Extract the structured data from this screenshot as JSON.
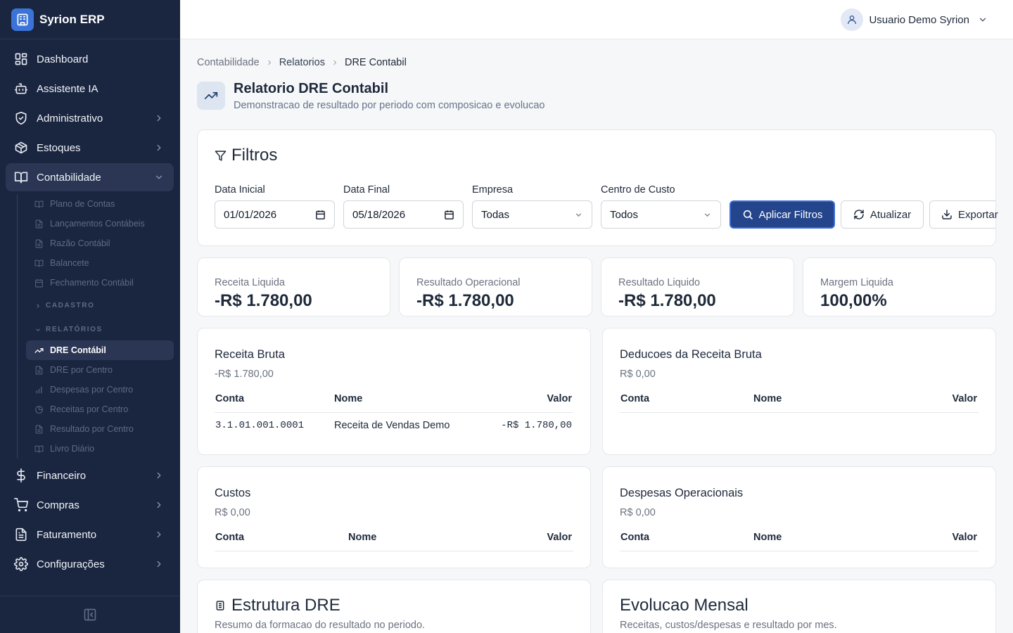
{
  "brand": {
    "name": "Syrion ERP"
  },
  "sidebar": {
    "items_top": [
      {
        "label": "Dashboard"
      },
      {
        "label": "Assistente IA"
      },
      {
        "label": "Administrativo"
      },
      {
        "label": "Estoques"
      },
      {
        "label": "Contabilidade"
      }
    ],
    "contabilidade_sub": [
      {
        "label": "Plano de Contas"
      },
      {
        "label": "Lançamentos Contábeis"
      },
      {
        "label": "Razão Contábil"
      },
      {
        "label": "Balancete"
      },
      {
        "label": "Fechamento Contábil"
      }
    ],
    "group_cadastro": "CADASTRO",
    "group_relatorios": "RELATÓRIOS",
    "relatorios_sub": [
      {
        "label": "DRE Contábil"
      },
      {
        "label": "DRE por Centro"
      },
      {
        "label": "Despesas por Centro"
      },
      {
        "label": "Receitas por Centro"
      },
      {
        "label": "Resultado por Centro"
      },
      {
        "label": "Livro Diário"
      }
    ],
    "items_bottom": [
      {
        "label": "Financeiro"
      },
      {
        "label": "Compras"
      },
      {
        "label": "Faturamento"
      },
      {
        "label": "Configurações"
      }
    ]
  },
  "header": {
    "user_name": "Usuario Demo Syrion"
  },
  "breadcrumb": [
    "Contabilidade",
    "Relatorios",
    "DRE Contabil"
  ],
  "page": {
    "title": "Relatorio DRE Contabil",
    "subtitle": "Demonstracao de resultado por periodo com composicao e evolucao"
  },
  "filters": {
    "title": "Filtros",
    "data_inicial_label": "Data Inicial",
    "data_inicial_value": "01/01/2026",
    "data_final_label": "Data Final",
    "data_final_value": "05/18/2026",
    "empresa_label": "Empresa",
    "empresa_value": "Todas",
    "centro_label": "Centro de Custo",
    "centro_value": "Todos",
    "apply_label": "Aplicar Filtros",
    "refresh_label": "Atualizar",
    "export_label": "Exportar"
  },
  "kpis": [
    {
      "label": "Receita Liquida",
      "value": "-R$ 1.780,00"
    },
    {
      "label": "Resultado Operacional",
      "value": "-R$ 1.780,00"
    },
    {
      "label": "Resultado Liquido",
      "value": "-R$ 1.780,00"
    },
    {
      "label": "Margem Liquida",
      "value": "100,00%"
    }
  ],
  "table_headers": {
    "conta": "Conta",
    "nome": "Nome",
    "valor": "Valor"
  },
  "sections": {
    "receita_bruta": {
      "title": "Receita Bruta",
      "total": "-R$ 1.780,00",
      "rows": [
        {
          "conta": "3.1.01.001.0001",
          "nome": "Receita de Vendas Demo",
          "valor": "-R$ 1.780,00"
        }
      ]
    },
    "deducoes": {
      "title": "Deducoes da Receita Bruta",
      "total": "R$ 0,00"
    },
    "custos": {
      "title": "Custos",
      "total": "R$ 0,00"
    },
    "despesas": {
      "title": "Despesas Operacionais",
      "total": "R$ 0,00"
    }
  },
  "estrutura": {
    "title": "Estrutura DRE",
    "subtitle": "Resumo da formacao do resultado no periodo."
  },
  "evolucao": {
    "title": "Evolucao Mensal",
    "subtitle": "Receitas, custos/despesas e resultado por mes."
  }
}
